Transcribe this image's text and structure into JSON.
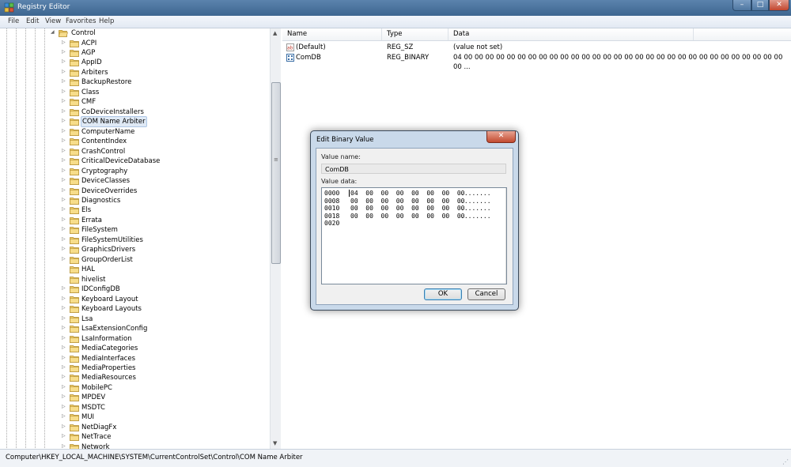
{
  "window": {
    "title": "Registry Editor"
  },
  "caption_buttons": {
    "minimize": "–",
    "maximize": "□",
    "close": "✕"
  },
  "menu": [
    "File",
    "Edit",
    "View",
    "Favorites",
    "Help"
  ],
  "tree": {
    "parent": "Control",
    "items": [
      "ACPI",
      "AGP",
      "AppID",
      "Arbiters",
      "BackupRestore",
      "Class",
      "CMF",
      "CoDeviceInstallers",
      "COM Name Arbiter",
      "ComputerName",
      "ContentIndex",
      "CrashControl",
      "CriticalDeviceDatabase",
      "Cryptography",
      "DeviceClasses",
      "DeviceOverrides",
      "Diagnostics",
      "Els",
      "Errata",
      "FileSystem",
      "FileSystemUtilities",
      "GraphicsDrivers",
      "GroupOrderList",
      "HAL",
      "hivelist",
      "IDConfigDB",
      "Keyboard Layout",
      "Keyboard Layouts",
      "Lsa",
      "LsaExtensionConfig",
      "LsaInformation",
      "MediaCategories",
      "MediaInterfaces",
      "MediaProperties",
      "MediaResources",
      "MobilePC",
      "MPDEV",
      "MSDTC",
      "MUI",
      "NetDiagFx",
      "NetTrace",
      "Network"
    ],
    "selected": "COM Name Arbiter",
    "no_expander": [
      "HAL",
      "hivelist"
    ]
  },
  "list": {
    "columns": [
      "Name",
      "Type",
      "Data"
    ],
    "rows": [
      {
        "name": "(Default)",
        "type": "REG_SZ",
        "data": "(value not set)",
        "icon": "string-value-icon"
      },
      {
        "name": "ComDB",
        "type": "REG_BINARY",
        "data": "04 00 00 00 00 00 00 00 00 00 00 00 00 00 00 00 00 00 00 00 00 00 00 00 00 00 00 00 00 00 00 00 ...",
        "icon": "binary-value-icon"
      }
    ]
  },
  "statusbar": {
    "path": "Computer\\HKEY_LOCAL_MACHINE\\SYSTEM\\CurrentControlSet\\Control\\COM Name Arbiter"
  },
  "dialog": {
    "title": "Edit Binary Value",
    "close": "✕",
    "value_name_label": "Value name:",
    "value_name": "ComDB",
    "value_data_label": "Value data:",
    "hex_rows": [
      {
        "addr": "0000",
        "bytes": "04  00  00  00  00  00  00  00",
        "ascii": "........"
      },
      {
        "addr": "0008",
        "bytes": "00  00  00  00  00  00  00  00",
        "ascii": "........"
      },
      {
        "addr": "0010",
        "bytes": "00  00  00  00  00  00  00  00",
        "ascii": "........"
      },
      {
        "addr": "0018",
        "bytes": "00  00  00  00  00  00  00  00",
        "ascii": "........"
      },
      {
        "addr": "0020",
        "bytes": "",
        "ascii": ""
      }
    ],
    "ok_label": "OK",
    "cancel_label": "Cancel"
  }
}
